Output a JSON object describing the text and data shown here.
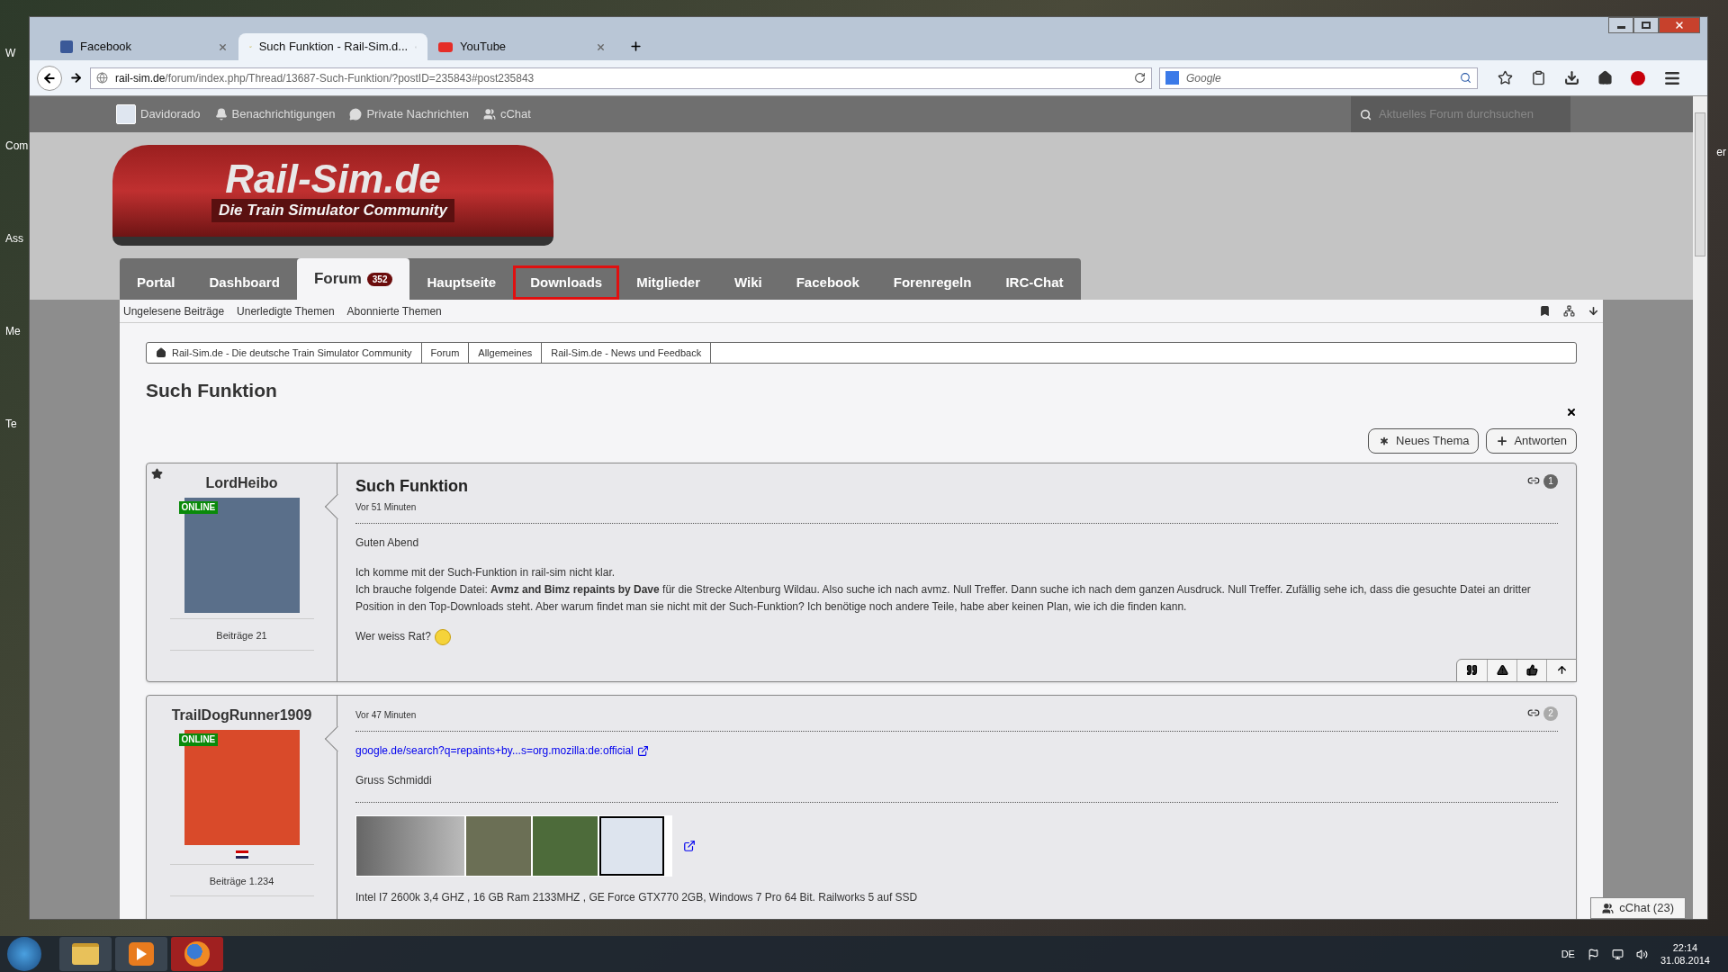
{
  "desktop": {
    "edge_labels": [
      "W",
      "Com",
      "Ass",
      "Me",
      "Te"
    ],
    "right_label": "er"
  },
  "browser": {
    "tabs": [
      {
        "label": "Facebook",
        "selected": false,
        "kind": "facebook"
      },
      {
        "label": "Such Funktion - Rail-Sim.d...",
        "selected": true,
        "kind": "railsim"
      },
      {
        "label": "YouTube",
        "selected": false,
        "kind": "youtube"
      }
    ],
    "url": {
      "domain": "rail-sim.de",
      "path": "/forum/index.php/Thread/13687-Such-Funktion/?postID=235843#post235843"
    },
    "search": {
      "placeholder": "Google"
    }
  },
  "site": {
    "user_bar": [
      {
        "label": "Davidorado",
        "kind": "avatar"
      },
      {
        "label": "Benachrichtigungen",
        "kind": "bell"
      },
      {
        "label": "Private Nachrichten",
        "kind": "chat"
      },
      {
        "label": "cChat",
        "kind": "users"
      }
    ],
    "search": {
      "placeholder": "Aktuelles Forum durchsuchen"
    },
    "logo": {
      "title": "Rail-Sim.de",
      "subtitle": "Die Train Simulator Community"
    },
    "nav": [
      {
        "label": "Portal",
        "selected": false,
        "highlighted": false
      },
      {
        "label": "Dashboard",
        "selected": false,
        "highlighted": false
      },
      {
        "label": "Forum",
        "selected": true,
        "highlighted": false,
        "badge": "352"
      },
      {
        "label": "Hauptseite",
        "selected": false,
        "highlighted": false
      },
      {
        "label": "Downloads",
        "selected": false,
        "highlighted": true
      },
      {
        "label": "Mitglieder",
        "selected": false,
        "highlighted": false
      },
      {
        "label": "Wiki",
        "selected": false,
        "highlighted": false
      },
      {
        "label": "Facebook",
        "selected": false,
        "highlighted": false
      },
      {
        "label": "Forenregeln",
        "selected": false,
        "highlighted": false
      },
      {
        "label": "IRC-Chat",
        "selected": false,
        "highlighted": false
      }
    ],
    "sub_nav": [
      "Ungelesene Beiträge",
      "Unerledigte Themen",
      "Abonnierte Themen"
    ],
    "breadcrumb": [
      "Rail-Sim.de - Die deutsche Train Simulator Community",
      "Forum",
      "Allgemeines",
      "Rail-Sim.de - News und Feedback"
    ],
    "title": "Such Funktion",
    "actions": [
      {
        "label": "Neues Thema",
        "kind": "star"
      },
      {
        "label": "Antworten",
        "kind": "plus"
      }
    ],
    "posts": [
      {
        "author": "LordHeibo",
        "online": "ONLINE",
        "starred": true,
        "flag": false,
        "count": "Beiträge 21",
        "title": "Such Funktion",
        "time": "Vor 51 Minuten",
        "number": "1",
        "toolbar": true,
        "blocks": [
          {
            "kind": "text",
            "lines": [
              "Guten Abend"
            ]
          },
          {
            "kind": "text",
            "lines": [
              "Ich komme mit der Such-Funktion in rail-sim nicht klar.",
              "Ich brauche folgende Datei: **Avmz and Bimz repaints by Dave** für die Strecke Altenburg Wildau. Also suche ich nach avmz. Null Treffer. Dann suche ich nach dem ganzen Ausdruck. Null Treffer. Zufällig sehe ich, dass die gesuchte Datei an dritter Position in den Top-Downloads steht. Aber warum findet man sie nicht mit der Such-Funktion? Ich benötige noch andere Teile, habe aber keinen Plan, wie ich die finden kann."
            ]
          },
          {
            "kind": "smiley",
            "text": "Wer weiss Rat?"
          }
        ]
      },
      {
        "author": "TrailDogRunner1909",
        "online": "ONLINE",
        "starred": false,
        "flag": true,
        "count": "Beiträge 1.234",
        "time": "Vor 47 Minuten",
        "number": "2",
        "toolbar": false,
        "blocks": [
          {
            "kind": "link",
            "text": "google.de/search?q=repaints+by...s=org.mozilla:de:official"
          },
          {
            "kind": "text",
            "lines": [
              "Gruss Schmiddi"
            ]
          },
          {
            "kind": "rule"
          },
          {
            "kind": "banner"
          },
          {
            "kind": "text",
            "lines": [
              "Intel I7 2600k 3,4 GHZ , 16 GB Ram 2133MHZ , GE Force GTX770 2GB, Windows 7 Pro 64 Bit. Railworks 5 auf SSD"
            ]
          }
        ]
      }
    ],
    "chat_button": "cChat (23)"
  },
  "taskbar": {
    "apps": [
      {
        "kind": "explorer",
        "selected": false
      },
      {
        "kind": "media",
        "selected": false
      },
      {
        "kind": "firefox",
        "selected": true
      }
    ],
    "language": "DE",
    "time": "22:14",
    "date": "31.08.2014"
  }
}
